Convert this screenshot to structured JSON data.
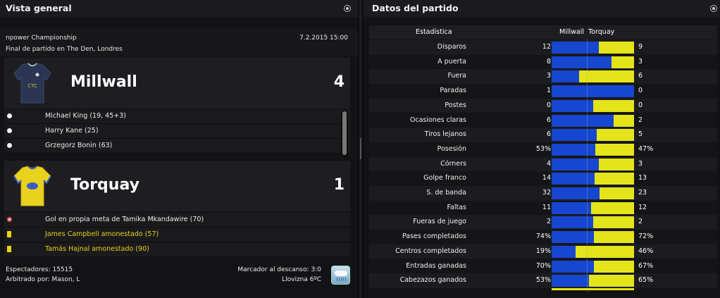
{
  "left_panel": {
    "title": "Vista general",
    "competition": "npower Championship",
    "datetime": "7.2.2015 15:00",
    "venue": "Final de partido en The Den, Londres",
    "home": {
      "name": "Millwall",
      "score": "4",
      "shirt_color": "#2a3553",
      "events": [
        {
          "type": "goal",
          "text": "Michael King (19, 45+3)"
        },
        {
          "type": "goal",
          "text": "Harry Kane (25)"
        },
        {
          "type": "goal",
          "text": "Grzegorz Bonin (63)"
        }
      ]
    },
    "away": {
      "name": "Torquay",
      "score": "1",
      "shirt_color": "#e9d21d",
      "events": [
        {
          "type": "own-goal",
          "text": "Gol en propia meta de Tamika Mkandawire (70)"
        },
        {
          "type": "yellow-card",
          "text": "James Campbell amonestado (57)"
        },
        {
          "type": "yellow-card",
          "text": "Tamás Hajnal amonestado (90)"
        }
      ]
    },
    "footer": {
      "attendance": "Espectadores: 15515",
      "referee": "Arbitrado por: Mason, L",
      "halftime": "Marcador al descanso: 3:0",
      "weather": "Llovizna 6ºC",
      "weather_icon": "drizzle-icon"
    }
  },
  "right_panel": {
    "title": "Datos del partido",
    "header_stat": "Estadística",
    "header_teams": "Millwall  Torquay",
    "colors": {
      "home": "#1747d0",
      "away": "#e4e41a"
    },
    "stats": [
      {
        "label": "Disparos",
        "home": "12",
        "away": "9",
        "home_share": 0.57
      },
      {
        "label": "A puerta",
        "home": "8",
        "away": "3",
        "home_share": 0.73
      },
      {
        "label": "Fuera",
        "home": "3",
        "away": "6",
        "home_share": 0.33
      },
      {
        "label": "Paradas",
        "home": "1",
        "away": "0",
        "home_share": 1.0
      },
      {
        "label": "Postes",
        "home": "0",
        "away": "0",
        "home_share": 0.5
      },
      {
        "label": "Ocasiones claras",
        "home": "6",
        "away": "2",
        "home_share": 0.75
      },
      {
        "label": "Tiros lejanos",
        "home": "6",
        "away": "5",
        "home_share": 0.55
      },
      {
        "label": "Posesión",
        "home": "53%",
        "away": "47%",
        "home_share": 0.53
      },
      {
        "label": "Córners",
        "home": "4",
        "away": "3",
        "home_share": 0.57
      },
      {
        "label": "Golpe franco",
        "home": "14",
        "away": "13",
        "home_share": 0.52
      },
      {
        "label": "S. de banda",
        "home": "32",
        "away": "23",
        "home_share": 0.58
      },
      {
        "label": "Faltas",
        "home": "11",
        "away": "12",
        "home_share": 0.48
      },
      {
        "label": "Fueras de juego",
        "home": "2",
        "away": "2",
        "home_share": 0.5
      },
      {
        "label": "Pases completados",
        "home": "74%",
        "away": "72%",
        "home_share": 0.51
      },
      {
        "label": "Centros completados",
        "home": "19%",
        "away": "46%",
        "home_share": 0.29
      },
      {
        "label": "Entradas ganadas",
        "home": "70%",
        "away": "67%",
        "home_share": 0.51
      },
      {
        "label": "Cabezazos ganados",
        "home": "53%",
        "away": "65%",
        "home_share": 0.45
      }
    ]
  }
}
